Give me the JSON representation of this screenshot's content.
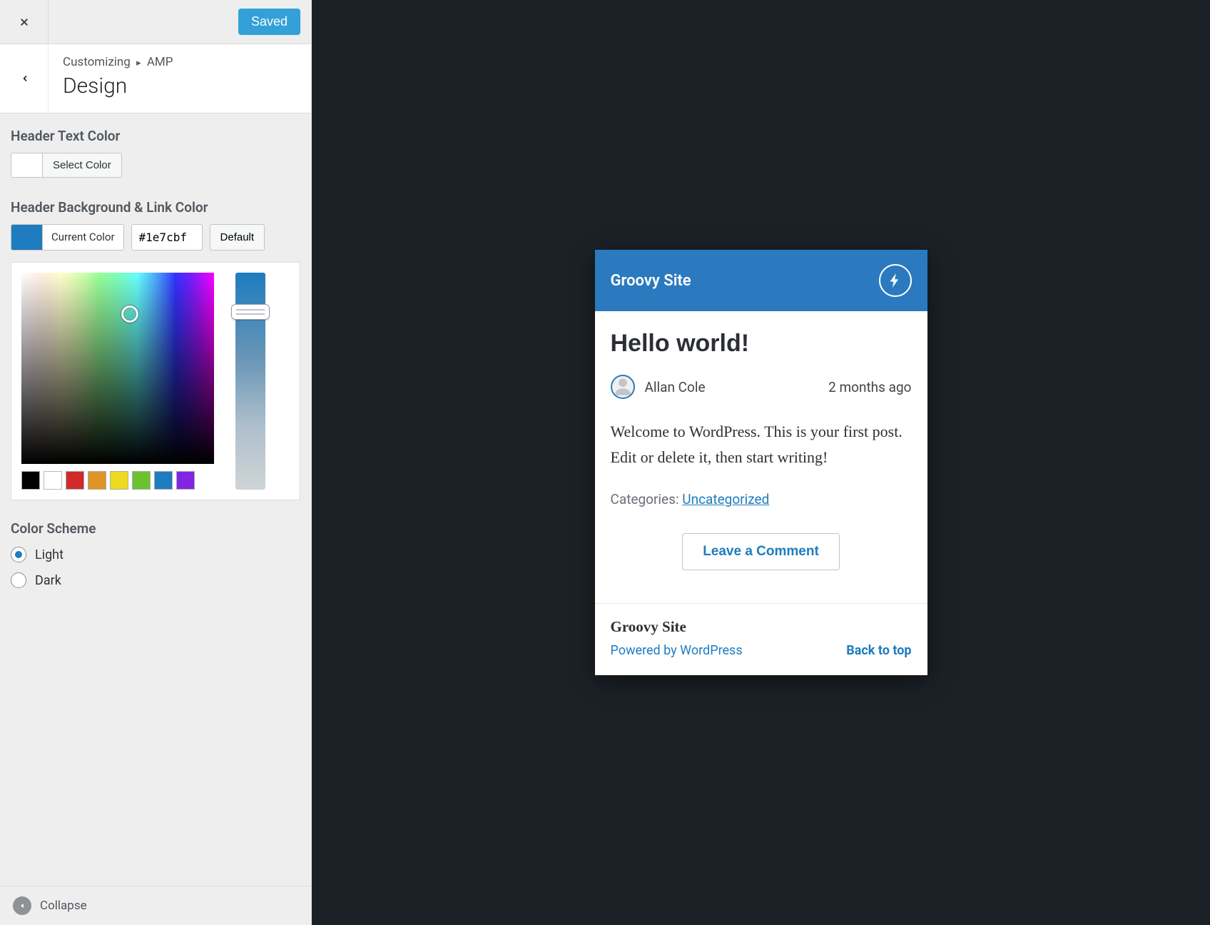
{
  "topbar": {
    "saved_label": "Saved"
  },
  "breadcrumb": {
    "parent": "Customizing",
    "section": "AMP",
    "title": "Design"
  },
  "header_text_color": {
    "label": "Header Text Color",
    "button": "Select Color",
    "swatch_hex": "#ffffff"
  },
  "header_bg_link": {
    "label": "Header Background & Link Color",
    "current_color_label": "Current Color",
    "current_color_hex": "#1e7cbf",
    "hex_value": "#1e7cbf",
    "default_label": "Default"
  },
  "palette": [
    "#000000",
    "#ffffff",
    "#d02a2a",
    "#e09327",
    "#eedb1f",
    "#6bc22e",
    "#1e7cbf",
    "#8224e3"
  ],
  "color_scheme": {
    "label": "Color Scheme",
    "options": [
      {
        "label": "Light",
        "checked": true
      },
      {
        "label": "Dark",
        "checked": false
      }
    ]
  },
  "collapse": {
    "label": "Collapse"
  },
  "preview": {
    "site_title": "Groovy Site",
    "post_title": "Hello world!",
    "author": "Allan Cole",
    "ago": "2 months ago",
    "content": "Welcome to WordPress. This is your first post. Edit or delete it, then start writing!",
    "categories_label": "Categories: ",
    "category": "Uncategorized",
    "leave_comment": "Leave a Comment",
    "footer_site": "Groovy Site",
    "powered_by": "Powered by WordPress",
    "back_to_top": "Back to top"
  }
}
